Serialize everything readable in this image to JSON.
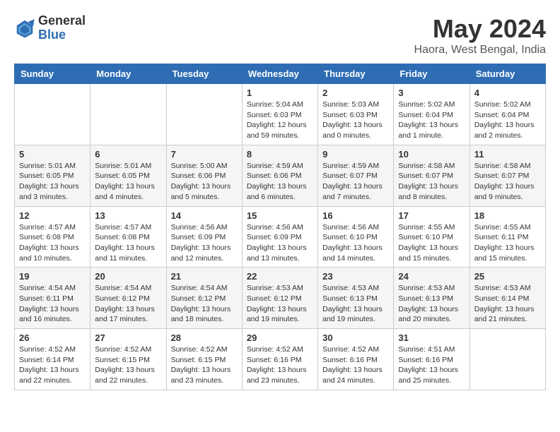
{
  "header": {
    "logo_general": "General",
    "logo_blue": "Blue",
    "month_year": "May 2024",
    "location": "Haora, West Bengal, India"
  },
  "days_of_week": [
    "Sunday",
    "Monday",
    "Tuesday",
    "Wednesday",
    "Thursday",
    "Friday",
    "Saturday"
  ],
  "weeks": [
    [
      {
        "day": "",
        "info": ""
      },
      {
        "day": "",
        "info": ""
      },
      {
        "day": "",
        "info": ""
      },
      {
        "day": "1",
        "info": "Sunrise: 5:04 AM\nSunset: 6:03 PM\nDaylight: 12 hours\nand 59 minutes."
      },
      {
        "day": "2",
        "info": "Sunrise: 5:03 AM\nSunset: 6:03 PM\nDaylight: 13 hours\nand 0 minutes."
      },
      {
        "day": "3",
        "info": "Sunrise: 5:02 AM\nSunset: 6:04 PM\nDaylight: 13 hours\nand 1 minute."
      },
      {
        "day": "4",
        "info": "Sunrise: 5:02 AM\nSunset: 6:04 PM\nDaylight: 13 hours\nand 2 minutes."
      }
    ],
    [
      {
        "day": "5",
        "info": "Sunrise: 5:01 AM\nSunset: 6:05 PM\nDaylight: 13 hours\nand 3 minutes."
      },
      {
        "day": "6",
        "info": "Sunrise: 5:01 AM\nSunset: 6:05 PM\nDaylight: 13 hours\nand 4 minutes."
      },
      {
        "day": "7",
        "info": "Sunrise: 5:00 AM\nSunset: 6:06 PM\nDaylight: 13 hours\nand 5 minutes."
      },
      {
        "day": "8",
        "info": "Sunrise: 4:59 AM\nSunset: 6:06 PM\nDaylight: 13 hours\nand 6 minutes."
      },
      {
        "day": "9",
        "info": "Sunrise: 4:59 AM\nSunset: 6:07 PM\nDaylight: 13 hours\nand 7 minutes."
      },
      {
        "day": "10",
        "info": "Sunrise: 4:58 AM\nSunset: 6:07 PM\nDaylight: 13 hours\nand 8 minutes."
      },
      {
        "day": "11",
        "info": "Sunrise: 4:58 AM\nSunset: 6:07 PM\nDaylight: 13 hours\nand 9 minutes."
      }
    ],
    [
      {
        "day": "12",
        "info": "Sunrise: 4:57 AM\nSunset: 6:08 PM\nDaylight: 13 hours\nand 10 minutes."
      },
      {
        "day": "13",
        "info": "Sunrise: 4:57 AM\nSunset: 6:08 PM\nDaylight: 13 hours\nand 11 minutes."
      },
      {
        "day": "14",
        "info": "Sunrise: 4:56 AM\nSunset: 6:09 PM\nDaylight: 13 hours\nand 12 minutes."
      },
      {
        "day": "15",
        "info": "Sunrise: 4:56 AM\nSunset: 6:09 PM\nDaylight: 13 hours\nand 13 minutes."
      },
      {
        "day": "16",
        "info": "Sunrise: 4:56 AM\nSunset: 6:10 PM\nDaylight: 13 hours\nand 14 minutes."
      },
      {
        "day": "17",
        "info": "Sunrise: 4:55 AM\nSunset: 6:10 PM\nDaylight: 13 hours\nand 15 minutes."
      },
      {
        "day": "18",
        "info": "Sunrise: 4:55 AM\nSunset: 6:11 PM\nDaylight: 13 hours\nand 15 minutes."
      }
    ],
    [
      {
        "day": "19",
        "info": "Sunrise: 4:54 AM\nSunset: 6:11 PM\nDaylight: 13 hours\nand 16 minutes."
      },
      {
        "day": "20",
        "info": "Sunrise: 4:54 AM\nSunset: 6:12 PM\nDaylight: 13 hours\nand 17 minutes."
      },
      {
        "day": "21",
        "info": "Sunrise: 4:54 AM\nSunset: 6:12 PM\nDaylight: 13 hours\nand 18 minutes."
      },
      {
        "day": "22",
        "info": "Sunrise: 4:53 AM\nSunset: 6:12 PM\nDaylight: 13 hours\nand 19 minutes."
      },
      {
        "day": "23",
        "info": "Sunrise: 4:53 AM\nSunset: 6:13 PM\nDaylight: 13 hours\nand 19 minutes."
      },
      {
        "day": "24",
        "info": "Sunrise: 4:53 AM\nSunset: 6:13 PM\nDaylight: 13 hours\nand 20 minutes."
      },
      {
        "day": "25",
        "info": "Sunrise: 4:53 AM\nSunset: 6:14 PM\nDaylight: 13 hours\nand 21 minutes."
      }
    ],
    [
      {
        "day": "26",
        "info": "Sunrise: 4:52 AM\nSunset: 6:14 PM\nDaylight: 13 hours\nand 22 minutes."
      },
      {
        "day": "27",
        "info": "Sunrise: 4:52 AM\nSunset: 6:15 PM\nDaylight: 13 hours\nand 22 minutes."
      },
      {
        "day": "28",
        "info": "Sunrise: 4:52 AM\nSunset: 6:15 PM\nDaylight: 13 hours\nand 23 minutes."
      },
      {
        "day": "29",
        "info": "Sunrise: 4:52 AM\nSunset: 6:16 PM\nDaylight: 13 hours\nand 23 minutes."
      },
      {
        "day": "30",
        "info": "Sunrise: 4:52 AM\nSunset: 6:16 PM\nDaylight: 13 hours\nand 24 minutes."
      },
      {
        "day": "31",
        "info": "Sunrise: 4:51 AM\nSunset: 6:16 PM\nDaylight: 13 hours\nand 25 minutes."
      },
      {
        "day": "",
        "info": ""
      }
    ]
  ]
}
